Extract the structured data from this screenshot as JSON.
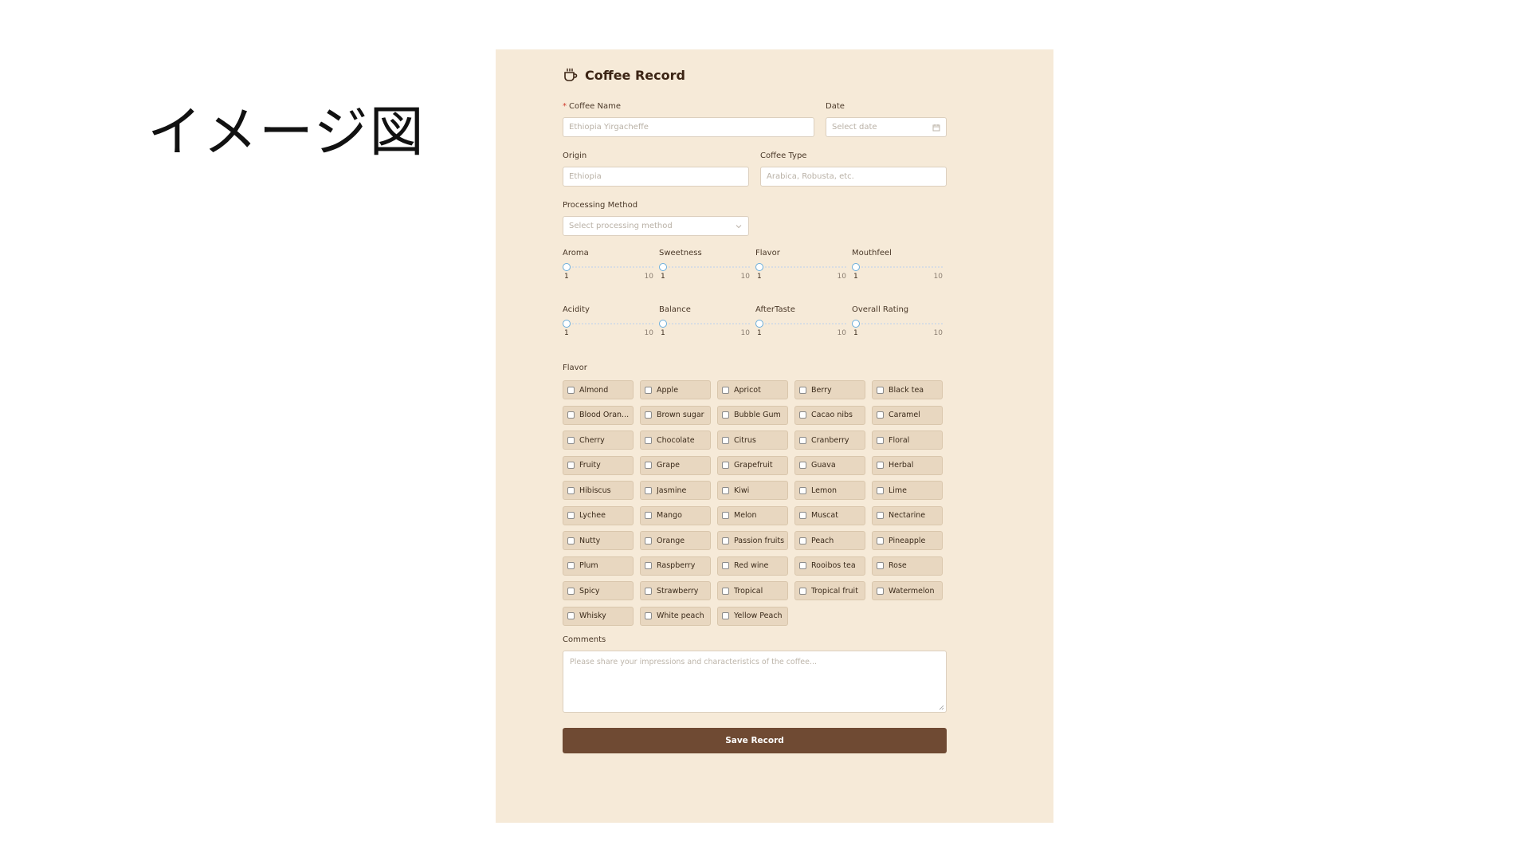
{
  "slide": {
    "label": "イメージ図"
  },
  "form": {
    "title": "Coffee Record",
    "required_mark": "*",
    "coffee_name": {
      "label": "Coffee Name",
      "placeholder": "Ethiopia Yirgacheffe"
    },
    "date": {
      "label": "Date",
      "placeholder": "Select date"
    },
    "origin": {
      "label": "Origin",
      "placeholder": "Ethiopia"
    },
    "coffee_type": {
      "label": "Coffee Type",
      "placeholder": "Arabica, Robusta, etc."
    },
    "processing": {
      "label": "Processing Method",
      "placeholder": "Select processing method"
    },
    "ratings": [
      {
        "label": "Aroma",
        "value": "1",
        "max": "10"
      },
      {
        "label": "Sweetness",
        "value": "1",
        "max": "10"
      },
      {
        "label": "Flavor",
        "value": "1",
        "max": "10"
      },
      {
        "label": "Mouthfeel",
        "value": "1",
        "max": "10"
      },
      {
        "label": "Acidity",
        "value": "1",
        "max": "10"
      },
      {
        "label": "Balance",
        "value": "1",
        "max": "10"
      },
      {
        "label": "AfterTaste",
        "value": "1",
        "max": "10"
      },
      {
        "label": "Overall Rating",
        "value": "1",
        "max": "10"
      }
    ],
    "flavor_label": "Flavor",
    "flavors": [
      "Almond",
      "Apple",
      "Apricot",
      "Berry",
      "Black tea",
      "Blood Oran...",
      "Brown sugar",
      "Bubble Gum",
      "Cacao nibs",
      "Caramel",
      "Cherry",
      "Chocolate",
      "Citrus",
      "Cranberry",
      "Floral",
      "Fruity",
      "Grape",
      "Grapefruit",
      "Guava",
      "Herbal",
      "Hibiscus",
      "Jasmine",
      "Kiwi",
      "Lemon",
      "Lime",
      "Lychee",
      "Mango",
      "Melon",
      "Muscat",
      "Nectarine",
      "Nutty",
      "Orange",
      "Passion fruits",
      "Peach",
      "Pineapple",
      "Plum",
      "Raspberry",
      "Red wine",
      "Rooibos tea",
      "Rose",
      "Spicy",
      "Strawberry",
      "Tropical",
      "Tropical fruit",
      "Watermelon",
      "Whisky",
      "White peach",
      "Yellow Peach"
    ],
    "comments": {
      "label": "Comments",
      "placeholder": "Please share your impressions and characteristics of the coffee..."
    },
    "save_label": "Save Record"
  },
  "colors": {
    "panel_bg": "#f6ead8",
    "chip_bg": "#e8d7c0",
    "button_bg": "#6f4a33",
    "required": "#d03a2c",
    "slider_accent": "#6aaedc"
  }
}
